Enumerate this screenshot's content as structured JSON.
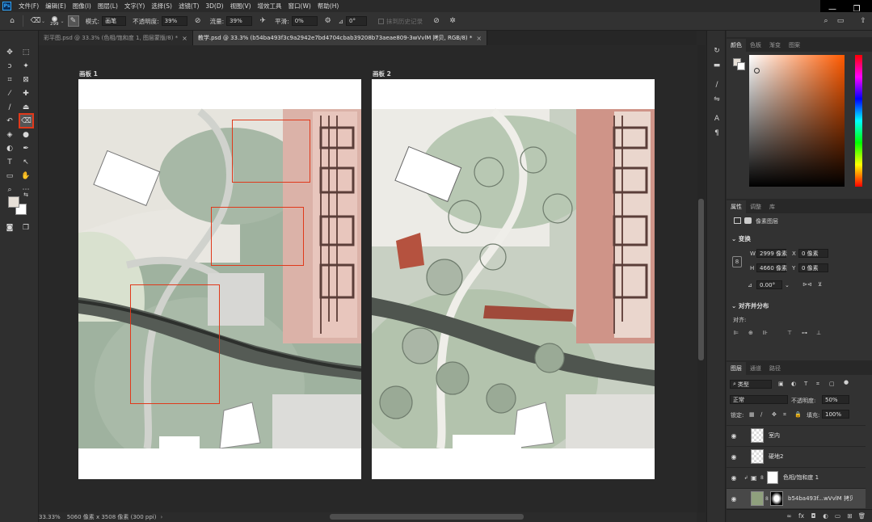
{
  "menu": {
    "items": [
      "文件(F)",
      "编辑(E)",
      "图像(I)",
      "图层(L)",
      "文字(Y)",
      "选择(S)",
      "滤镜(T)",
      "3D(D)",
      "视图(V)",
      "增效工具",
      "窗口(W)",
      "帮助(H)"
    ]
  },
  "options": {
    "brush_size": "299",
    "mode_label": "模式:",
    "mode_value": "画笔",
    "opacity_label": "不透明度:",
    "opacity_value": "39%",
    "flow_label": "流量:",
    "flow_value": "39%",
    "smooth_label": "平滑:",
    "smooth_value": "0%",
    "angle_value": "0°",
    "erase_history_label": "抹到历史记录"
  },
  "tabs": [
    {
      "label": "彩平图.psd @ 33.3% (色相/饱和度 1, 图层蒙版/8) *"
    },
    {
      "label": "教学.psd @ 33.3% (b54ba493f3c9a2942e7bd4704cbab39208b73aeae809-3wVvlM 拷贝, RGB/8) *"
    }
  ],
  "artboards": [
    {
      "label": "画板 1"
    },
    {
      "label": "画板 2"
    }
  ],
  "status": {
    "zoom": "33.33%",
    "doc_info": "5060 像素 x 3508 像素 (300 ppi)"
  },
  "color_panel": {
    "tabs": [
      "颜色",
      "色板",
      "渐变",
      "图案"
    ]
  },
  "properties_panel": {
    "tabs": [
      "属性",
      "调整",
      "库"
    ],
    "pixel_layer_label": "像素图层",
    "transform_title": "变换",
    "w_label": "W",
    "w_value": "2999 像素",
    "x_label": "X",
    "x_value": "0 像素",
    "h_label": "H",
    "h_value": "4660 像素",
    "y_label": "Y",
    "y_value": "0 像素",
    "angle_value": "0.00°",
    "align_title": "对齐并分布",
    "align_label": "对齐:"
  },
  "layers_panel": {
    "tabs": [
      "图层",
      "通道",
      "路径"
    ],
    "filter_label": "类型",
    "blend_mode": "正常",
    "opacity_label": "不透明度:",
    "opacity_value": "50%",
    "lock_label": "锁定:",
    "fill_label": "填充:",
    "fill_value": "100%",
    "layers": [
      {
        "name": "室内"
      },
      {
        "name": "硬地2"
      },
      {
        "name": "色相/饱和度 1"
      },
      {
        "name": "b54ba493f...wVvlM 拷贝"
      }
    ],
    "footer_icons": [
      "link-icon",
      "fx-icon",
      "mask-icon",
      "adjustment-icon",
      "group-icon",
      "new-layer-icon",
      "trash-icon"
    ]
  },
  "colors": {
    "accent_selection": "#e0391b",
    "panel_bg": "#323232",
    "canvas_bg": "#282828"
  }
}
